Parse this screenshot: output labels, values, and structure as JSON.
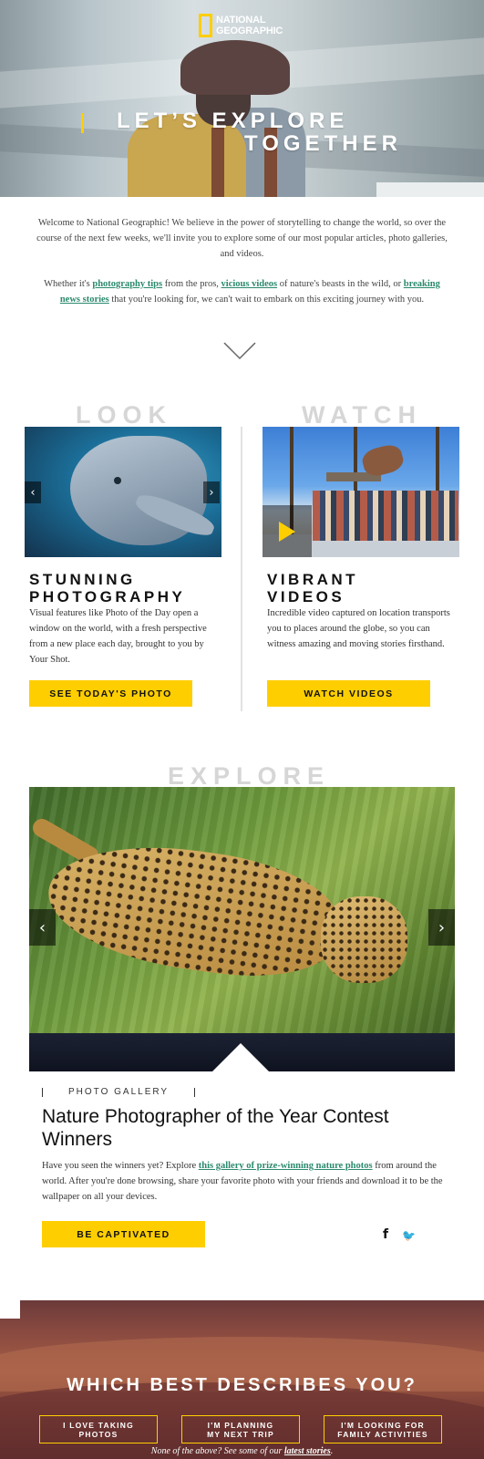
{
  "brand": {
    "logo_line1": "NATIONAL",
    "logo_line2": "GEOGRAPHIC",
    "accent": "#ffce00",
    "link": "#2b8a6e"
  },
  "hero": {
    "title_line1": "LET’S EXPLORE",
    "title_line2": "TOGETHER"
  },
  "intro": {
    "p1": "Welcome to National Geographic! We believe in the power of storytelling to change the world, so over the course of the next few weeks, we'll invite you to explore some of our most popular articles, photo galleries, and videos.",
    "p2_a": "Whether it's ",
    "link_photo_tips": "photography tips",
    "p2_b": " from the pros, ",
    "link_videos": "vicious videos",
    "p2_c": " of nature's beasts in the wild, or ",
    "link_news": "breaking news stories",
    "p2_d": " that you're looking for, we can't wait to embark on this exciting journey with you."
  },
  "look": {
    "label": "LOOK",
    "title_line1": "STUNNING",
    "title_line2": "PHOTOGRAPHY",
    "text": "Visual features like Photo of the Day open a window on the world, with a fresh perspective from a new place each day, brought to you by Your Shot.",
    "button": "SEE TODAY'S PHOTO",
    "prev": "‹",
    "next": "›"
  },
  "watch": {
    "label": "WATCH",
    "title_line1": "VIBRANT",
    "title_line2": "VIDEOS",
    "text": "Incredible video captured on location transports you to places around the globe, so you can witness amazing and moving stories firsthand.",
    "button": "WATCH VIDEOS"
  },
  "explore": {
    "label": "EXPLORE",
    "prev": "‹",
    "next": "›",
    "category": "PHOTO GALLERY",
    "title": "Nature Photographer of the Year Contest Winners",
    "text_a": "Have you seen the winners yet? Explore ",
    "link": "this gallery of prize-winning nature photos",
    "text_b": " from around the world. After you're done browsing, share your favorite photo with your friends and download it to be the wallpaper on all your devices.",
    "button": "BE CAPTIVATED",
    "facebook": "f",
    "twitter": "🐦"
  },
  "survey": {
    "title": "WHICH BEST DESCRIBES YOU?",
    "options": [
      {
        "line1": "I LOVE TAKING",
        "line2": "PHOTOS"
      },
      {
        "line1": "I'M PLANNING",
        "line2": "MY NEXT TRIP"
      },
      {
        "line1": "I'M LOOKING FOR",
        "line2": "FAMILY ACTIVITIES"
      }
    ],
    "footer_a": "None of the above? See some of our ",
    "footer_link": "latest stories",
    "footer_b": "."
  }
}
